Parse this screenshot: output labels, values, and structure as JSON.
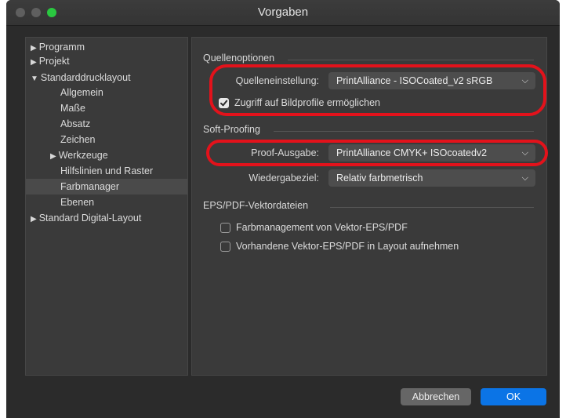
{
  "window": {
    "title": "Vorgaben",
    "traffic_lights": [
      "close-inactive",
      "minimize-inactive",
      "zoom-active"
    ],
    "colors": {
      "background": "#2b2b2b",
      "panel": "#3a3a3a",
      "highlight_annotation": "#e3121b",
      "ok_button": "#0b74e6",
      "zoom_light": "#2ac840"
    }
  },
  "sidebar": {
    "items": [
      {
        "label": "Programm",
        "icon": "triangle-right-icon"
      },
      {
        "label": "Projekt",
        "icon": "triangle-right-icon"
      },
      {
        "label": "Standarddrucklayout",
        "icon": "triangle-down-icon"
      },
      {
        "label": "Allgemein"
      },
      {
        "label": "Maße"
      },
      {
        "label": "Absatz"
      },
      {
        "label": "Zeichen"
      },
      {
        "label": "Werkzeuge",
        "icon": "triangle-right-icon"
      },
      {
        "label": "Hilfslinien und Raster"
      },
      {
        "label": "Farbmanager",
        "selected": true
      },
      {
        "label": "Ebenen"
      },
      {
        "label": "Standard Digital-Layout",
        "icon": "triangle-right-icon"
      }
    ]
  },
  "panel": {
    "quellenoptionen": {
      "title": "Quellenoptionen",
      "source_label": "Quelleneinstellung:",
      "source_value": "PrintAlliance - ISOCoated_v2 sRGB",
      "access_label": "Zugriff auf Bildprofile ermöglichen",
      "access_checked": true
    },
    "softproofing": {
      "title": "Soft-Proofing",
      "proof_label": "Proof-Ausgabe:",
      "proof_value": "PrintAlliance CMYK+ ISOcoatedv2",
      "render_label": "Wiedergabeziel:",
      "render_value": "Relativ farbmetrisch"
    },
    "eps": {
      "title": "EPS/PDF-Vektordateien",
      "option1_label": "Farbmanagement von Vektor-EPS/PDF",
      "option1_checked": false,
      "option2_label": "Vorhandene Vektor-EPS/PDF in Layout aufnehmen",
      "option2_checked": false
    }
  },
  "footer": {
    "cancel_label": "Abbrechen",
    "ok_label": "OK"
  }
}
